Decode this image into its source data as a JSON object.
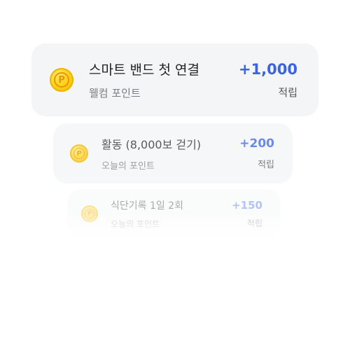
{
  "colors": {
    "accent": "#3a64e0",
    "card_background": "#f4f5f7",
    "coin": "#ffd21e"
  },
  "point_items": [
    {
      "icon": "coin-p-icon",
      "coin_letter": "P",
      "title": "스마트 밴드 첫 연결",
      "subtitle": "웰컴 포인트",
      "amount": "+1,000",
      "unit": "적립"
    },
    {
      "icon": "coin-p-icon",
      "coin_letter": "P",
      "title": "활동 (8,000보 걷기)",
      "subtitle": "오늘의 포인트",
      "amount": "+200",
      "unit": "적립"
    },
    {
      "icon": "coin-p-icon",
      "coin_letter": "P",
      "title": "식단기록 1일 2회",
      "subtitle": "오늘의 포인트",
      "amount": "+150",
      "unit": "적립"
    }
  ]
}
